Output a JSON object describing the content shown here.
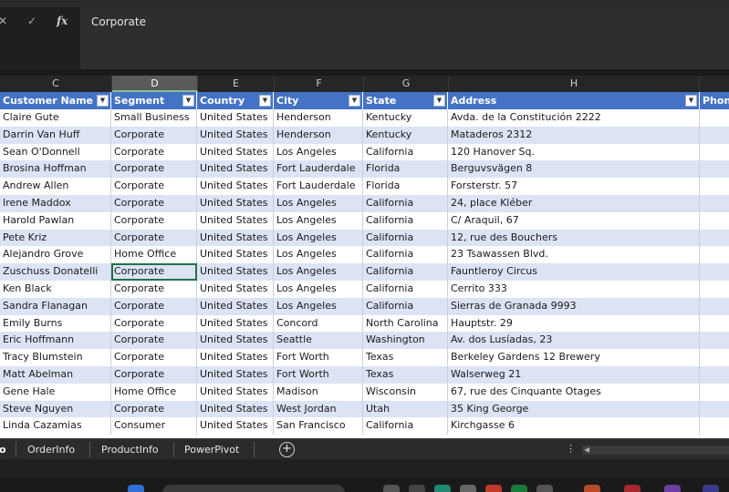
{
  "formula_bar": {
    "cancel_icon": "close-icon",
    "enter_icon": "check-icon",
    "fx_label": "fx",
    "value": "Corporate"
  },
  "column_letters": [
    "C",
    "D",
    "E",
    "F",
    "G",
    "H"
  ],
  "selected_column": "D",
  "table": {
    "headers": [
      "Customer Name",
      "Segment",
      "Country",
      "City",
      "State",
      "Address",
      "Phon"
    ],
    "rows": [
      [
        "Claire Gute",
        "Small Business",
        "United States",
        "Henderson",
        "Kentucky",
        "Avda. de la Constitución 2222",
        ""
      ],
      [
        "Darrin Van Huff",
        "Corporate",
        "United States",
        "Henderson",
        "Kentucky",
        "Mataderos  2312",
        ""
      ],
      [
        "Sean O'Donnell",
        "Corporate",
        "United States",
        "Los Angeles",
        "California",
        "120 Hanover Sq.",
        ""
      ],
      [
        "Brosina Hoffman",
        "Corporate",
        "United States",
        "Fort Lauderdale",
        "Florida",
        "Berguvsvägen  8",
        ""
      ],
      [
        "Andrew Allen",
        "Corporate",
        "United States",
        "Fort Lauderdale",
        "Florida",
        "Forsterstr. 57",
        ""
      ],
      [
        "Irene Maddox",
        "Corporate",
        "United States",
        "Los Angeles",
        "California",
        "24, place Kléber",
        ""
      ],
      [
        "Harold Pawlan",
        "Corporate",
        "United States",
        "Los Angeles",
        "California",
        "C/ Araquil, 67",
        ""
      ],
      [
        "Pete Kriz",
        "Corporate",
        "United States",
        "Los Angeles",
        "California",
        "12, rue des Bouchers",
        ""
      ],
      [
        "Alejandro Grove",
        "Home Office",
        "United States",
        "Los Angeles",
        "California",
        "23 Tsawassen Blvd.",
        ""
      ],
      [
        "Zuschuss Donatelli",
        "Corporate",
        "United States",
        "Los Angeles",
        "California",
        "Fauntleroy Circus",
        ""
      ],
      [
        "Ken Black",
        "Corporate",
        "United States",
        "Los Angeles",
        "California",
        "Cerrito 333",
        ""
      ],
      [
        "Sandra Flanagan",
        "Corporate",
        "United States",
        "Los Angeles",
        "California",
        "Sierras de Granada 9993",
        ""
      ],
      [
        "Emily Burns",
        "Corporate",
        "United States",
        "Concord",
        "North Carolina",
        "Hauptstr. 29",
        ""
      ],
      [
        "Eric Hoffmann",
        "Corporate",
        "United States",
        "Seattle",
        "Washington",
        "Av. dos Lusíadas, 23",
        ""
      ],
      [
        "Tracy Blumstein",
        "Corporate",
        "United States",
        "Fort Worth",
        "Texas",
        "Berkeley Gardens 12  Brewery",
        ""
      ],
      [
        "Matt Abelman",
        "Corporate",
        "United States",
        "Fort Worth",
        "Texas",
        "Walserweg 21",
        ""
      ],
      [
        "Gene Hale",
        "Home Office",
        "United States",
        "Madison",
        "Wisconsin",
        "67, rue des Cinquante Otages",
        ""
      ],
      [
        "Steve Nguyen",
        "Corporate",
        "United States",
        "West Jordan",
        "Utah",
        "35 King George",
        ""
      ],
      [
        "Linda Cazamias",
        "Consumer",
        "United States",
        "San Francisco",
        "California",
        "Kirchgasse 6",
        ""
      ]
    ]
  },
  "sheet_tabs": [
    "o",
    "OrderInfo",
    "ProductInfo",
    "PowerPivot"
  ],
  "active_tab": "o",
  "add_sheet_label": "+",
  "tab_menu_label": "⋮",
  "colors": {
    "header_blue": "#4472c4",
    "band_blue": "#dce3f4",
    "active_cell_green": "#217346"
  }
}
